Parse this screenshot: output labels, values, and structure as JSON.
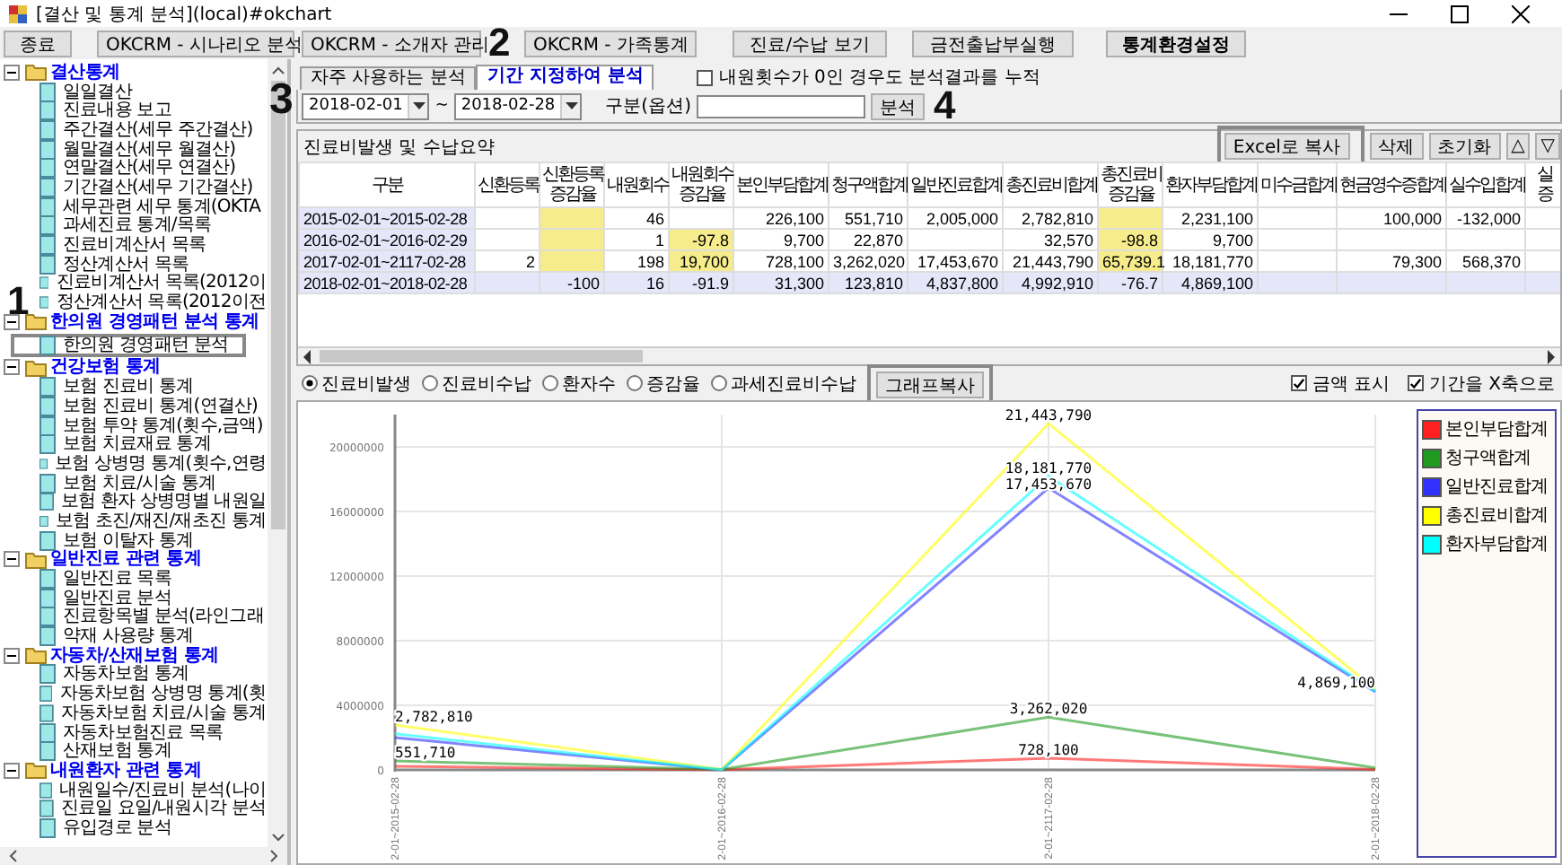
{
  "window": {
    "title": "[결산 및 통계 분석](local)#okchart"
  },
  "toolbar": [
    {
      "label": "종료",
      "bold": false
    },
    {
      "label": "OKCRM - 시나리오 분석",
      "bold": false
    },
    {
      "label": "OKCRM - 소개자 관리",
      "bold": false
    },
    {
      "label": "OKCRM - 가족통계",
      "bold": false
    },
    {
      "label": "진료/수납 보기",
      "bold": false
    },
    {
      "label": "금전출납부실행",
      "bold": false
    },
    {
      "label": "통계환경설정",
      "bold": true
    }
  ],
  "sidebar": {
    "groups": [
      {
        "label": "결산통계",
        "expanded": true,
        "children": [
          {
            "label": "일일결산",
            "outlined": false
          },
          {
            "label": "진료내용 보고",
            "outlined": false
          },
          {
            "label": "주간결산(세무 주간결산)",
            "outlined": false
          },
          {
            "label": "월말결산(세무 월결산)",
            "outlined": false
          },
          {
            "label": "연말결산(세무 연결산)",
            "outlined": false
          },
          {
            "label": "기간결산(세무 기간결산)",
            "outlined": false
          },
          {
            "label": "세무관련 세무 통계(OKTA",
            "outlined": false
          },
          {
            "label": "과세진료 통계/목록",
            "outlined": false
          },
          {
            "label": "진료비계산서 목록",
            "outlined": false
          },
          {
            "label": "정산계산서 목록",
            "outlined": false
          },
          {
            "label": "진료비계산서 목록(2012이",
            "outlined": false
          },
          {
            "label": "정산계산서 목록(2012이전",
            "outlined": false
          }
        ]
      },
      {
        "label": "한의원 경영패턴 분석 통계",
        "expanded": true,
        "children": [
          {
            "label": "한의원 경영패턴 분석",
            "outlined": true
          }
        ]
      },
      {
        "label": "건강보험 통계",
        "expanded": true,
        "children": [
          {
            "label": "보험 진료비 통계",
            "outlined": false
          },
          {
            "label": "보험 진료비 통계(연결산)",
            "outlined": false
          },
          {
            "label": "보험 투약 통계(횟수,금액)",
            "outlined": false
          },
          {
            "label": "보험 치료재료 통계",
            "outlined": false
          },
          {
            "label": "보험 상병명 통계(횟수,연령",
            "outlined": false
          },
          {
            "label": "보험 치료/시술 통계",
            "outlined": false
          },
          {
            "label": "보험 환자 상병명별 내원일",
            "outlined": false
          },
          {
            "label": "보험 초진/재진/재초진 통계",
            "outlined": false
          },
          {
            "label": "보험 이탈자 통계",
            "outlined": false
          }
        ]
      },
      {
        "label": "일반진료 관련 통계",
        "expanded": true,
        "children": [
          {
            "label": "일반진료 목록",
            "outlined": false
          },
          {
            "label": "일반진료 분석",
            "outlined": false
          },
          {
            "label": "진료항목별 분석(라인그래",
            "outlined": false
          },
          {
            "label": "약재 사용량 통계",
            "outlined": false
          }
        ]
      },
      {
        "label": "자동차/산재보험 통계",
        "expanded": true,
        "children": [
          {
            "label": "자동차보험 통계",
            "outlined": false
          },
          {
            "label": "자동차보험 상병명 통계(횟",
            "outlined": false
          },
          {
            "label": "자동차보험 치료/시술 통계",
            "outlined": false
          },
          {
            "label": "자동차보험진료 목록",
            "outlined": false
          },
          {
            "label": "산재보험 통계",
            "outlined": false
          }
        ]
      },
      {
        "label": "내원환자 관련 통계",
        "expanded": true,
        "children": [
          {
            "label": "내원일수/진료비 분석(나이",
            "outlined": false
          },
          {
            "label": "진료일 요일/내원시각 분석",
            "outlined": false
          },
          {
            "label": "유입경로 분석",
            "outlined": false
          }
        ]
      }
    ]
  },
  "tabs": [
    {
      "label": "자주 사용하는 분석",
      "selected": false
    },
    {
      "label": "기간 지정하여 분석",
      "selected": true
    }
  ],
  "accumulate_zero_visits": {
    "label": "내원횟수가 0인 경우도 분석결과를 누적",
    "checked": false
  },
  "filter": {
    "start_date": "2018-02-01",
    "separator": "~",
    "end_date": "2018-02-28",
    "category_label": "구분(옵션)",
    "analyze_button": "분석"
  },
  "summary": {
    "title": "진료비발생 및 수납요약",
    "buttons": [
      {
        "label": "Excel로 복사",
        "outlined": true
      },
      {
        "label": "삭제",
        "outlined": false
      },
      {
        "label": "초기화",
        "outlined": false
      },
      {
        "label": "△",
        "outlined": false
      },
      {
        "label": "▽",
        "outlined": false
      }
    ],
    "columns": [
      "구분",
      "신환등록",
      "신환등록 증감율",
      "내원회수",
      "내원회수 증감율",
      "본인부담합계",
      "청구액합계",
      "일반진료합계",
      "총진료비합계",
      "총진료비 증감율",
      "환자부담합계",
      "미수금합계",
      "현금영수증합계",
      "실수입합계",
      "실 증"
    ],
    "rows": [
      {
        "selected": false,
        "cells": [
          "2015-02-01~2015-02-28",
          "",
          "",
          "46",
          "",
          "226,100",
          "551,710",
          "2,005,000",
          "2,782,810",
          "",
          "2,231,100",
          "",
          "100,000",
          "-132,000",
          ""
        ],
        "highlighted": [
          false,
          false,
          true,
          false,
          false,
          false,
          false,
          false,
          false,
          true,
          false,
          false,
          false,
          false,
          false
        ]
      },
      {
        "selected": false,
        "cells": [
          "2016-02-01~2016-02-29",
          "",
          "",
          "1",
          "-97.8",
          "9,700",
          "22,870",
          "",
          "32,570",
          "-98.8",
          "9,700",
          "",
          "",
          "",
          ""
        ],
        "highlighted": [
          false,
          false,
          true,
          false,
          true,
          false,
          false,
          false,
          false,
          true,
          false,
          false,
          false,
          false,
          false
        ]
      },
      {
        "selected": false,
        "cells": [
          "2017-02-01~2117-02-28",
          "2",
          "",
          "198",
          "19,700",
          "728,100",
          "3,262,020",
          "17,453,670",
          "21,443,790",
          "65,739.1",
          "18,181,770",
          "",
          "79,300",
          "568,370",
          ""
        ],
        "highlighted": [
          false,
          false,
          true,
          false,
          true,
          false,
          false,
          false,
          false,
          true,
          false,
          false,
          false,
          false,
          false
        ]
      },
      {
        "selected": true,
        "cells": [
          "2018-02-01~2018-02-28",
          "",
          "-100",
          "16",
          "-91.9",
          "31,300",
          "123,810",
          "4,837,800",
          "4,992,910",
          "-76.7",
          "4,869,100",
          "",
          "",
          "",
          ""
        ],
        "highlighted": [
          false,
          false,
          false,
          false,
          false,
          false,
          false,
          false,
          false,
          false,
          false,
          false,
          false,
          false,
          false
        ]
      }
    ]
  },
  "chart_options": {
    "modes": [
      {
        "label": "진료비발생",
        "selected": true
      },
      {
        "label": "진료비수납",
        "selected": false
      },
      {
        "label": "환자수",
        "selected": false
      },
      {
        "label": "증감율",
        "selected": false
      },
      {
        "label": "과세진료비수납",
        "selected": false
      }
    ],
    "copy_button": {
      "label": "그래프복사",
      "outlined": true
    },
    "toggles": [
      {
        "label": "금액 표시",
        "checked": true
      },
      {
        "label": "기간을 X축으로",
        "checked": true
      }
    ]
  },
  "chart": {
    "chart_data": {
      "type": "line",
      "categories": [
        "2-01~2015-02-28",
        "2-01~2016-02-28",
        "2-01~2117-02-28",
        "2-01~2018-02-28"
      ],
      "ylim": [
        0,
        22000000
      ],
      "yticks": [
        0,
        4000000,
        8000000,
        12000000,
        16000000,
        20000000
      ],
      "grid": true,
      "value_labels": [
        [
          null,
          null,
          "728,100",
          null
        ],
        [
          "551,710",
          null,
          "3,262,020",
          null
        ],
        [
          null,
          null,
          "17,453,670",
          null
        ],
        [
          "2,782,810",
          null,
          "21,443,790",
          null
        ],
        [
          null,
          null,
          "18,181,770",
          "4,869,100"
        ]
      ],
      "series": [
        {
          "name": "본인부담합계",
          "color": "#ff2020",
          "values": [
            226100,
            9700,
            728100,
            31300
          ]
        },
        {
          "name": "청구액합계",
          "color": "#209a20",
          "values": [
            551710,
            22870,
            3262020,
            123810
          ]
        },
        {
          "name": "일반진료합계",
          "color": "#3030ff",
          "values": [
            2005000,
            0,
            17453670,
            4837800
          ]
        },
        {
          "name": "총진료비합계",
          "color": "#ffff00",
          "values": [
            2782810,
            32570,
            21443790,
            4992910
          ]
        },
        {
          "name": "환자부담합계",
          "color": "#00ffff",
          "values": [
            2231100,
            9700,
            18181770,
            4869100
          ]
        }
      ]
    }
  },
  "callouts": [
    {
      "label": "1"
    },
    {
      "label": "2"
    },
    {
      "label": "3"
    },
    {
      "label": "4"
    }
  ]
}
